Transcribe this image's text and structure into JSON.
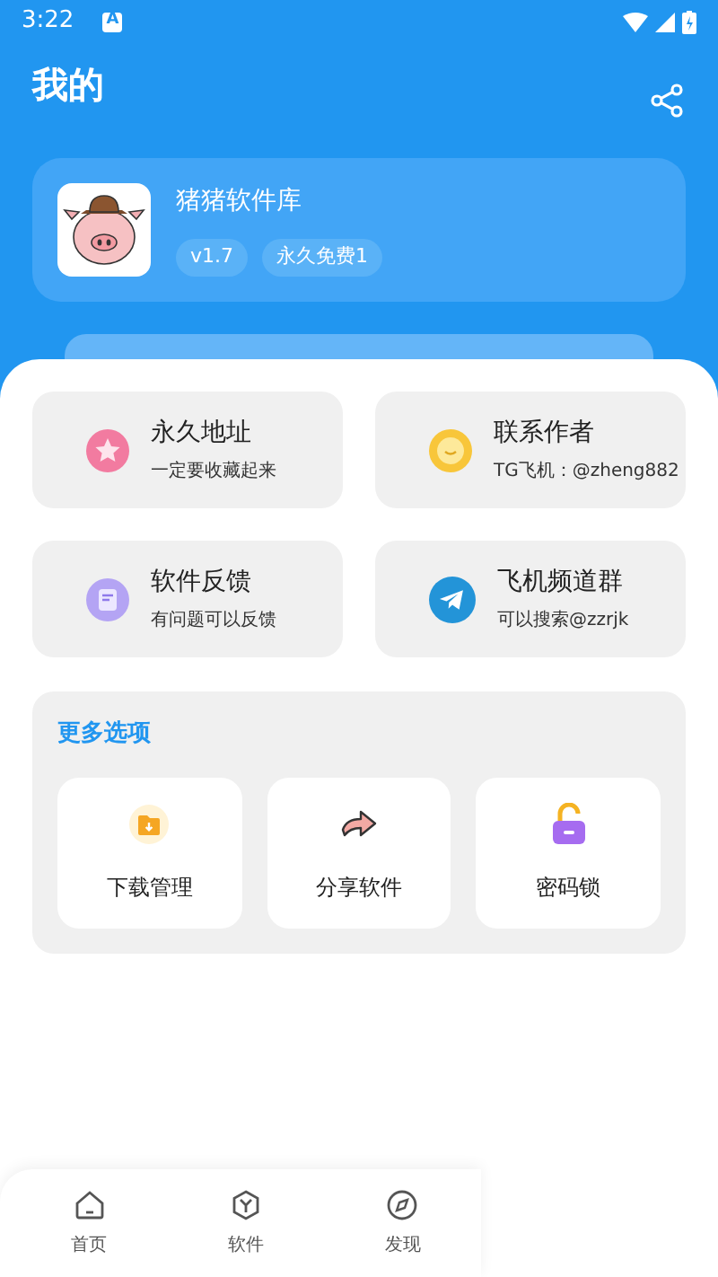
{
  "status_bar": {
    "time": "3:22",
    "notification": "A"
  },
  "header": {
    "title": "我的"
  },
  "app_card": {
    "name": "猪猪软件库",
    "tags": [
      "v1.7",
      "永久免费1"
    ]
  },
  "links": [
    {
      "kind": "star",
      "title": "永久地址",
      "subtitle": "一定要收藏起来"
    },
    {
      "kind": "chat",
      "title": "联系作者",
      "subtitle": "TG飞机：@zheng882"
    },
    {
      "kind": "note",
      "title": "软件反馈",
      "subtitle": "有问题可以反馈"
    },
    {
      "kind": "plane",
      "title": "飞机频道群",
      "subtitle": "可以搜索@zzrjk"
    }
  ],
  "more_options": {
    "title": "更多选项",
    "items": [
      {
        "kind": "download",
        "label": "下载管理"
      },
      {
        "kind": "share",
        "label": "分享软件"
      },
      {
        "kind": "lock",
        "label": "密码锁"
      }
    ]
  },
  "bottom_nav": [
    {
      "kind": "home",
      "label": "首页",
      "selected": false
    },
    {
      "kind": "software",
      "label": "软件",
      "selected": false
    },
    {
      "kind": "discover",
      "label": "发现",
      "selected": false
    }
  ]
}
